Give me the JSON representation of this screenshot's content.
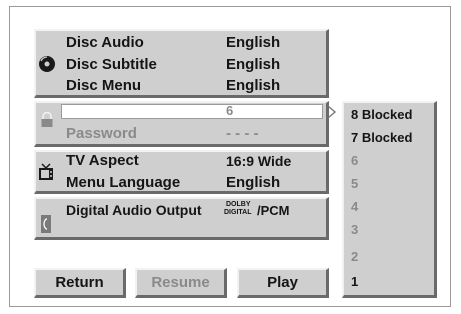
{
  "menu": {
    "disc_audio": {
      "label": "Disc Audio",
      "value": "English"
    },
    "disc_subtitle": {
      "label": "Disc Subtitle",
      "value": "English"
    },
    "disc_menu": {
      "label": "Disc Menu",
      "value": "English"
    },
    "rating_value": "6",
    "password": {
      "label": "Password",
      "value": "- - - -"
    },
    "tv_aspect": {
      "label": "TV Aspect",
      "value": "16:9 Wide"
    },
    "menu_language": {
      "label": "Menu Language",
      "value": "English"
    },
    "digital_audio_output": {
      "label": "Digital Audio Output",
      "dolby_line1": "DOLBY",
      "dolby_line2": "DIGITAL",
      "value": "/PCM"
    }
  },
  "rating_list": [
    "8 Blocked",
    "7 Blocked",
    "6",
    "5",
    "4",
    "3",
    "2",
    "1"
  ],
  "buttons": {
    "return": "Return",
    "resume": "Resume",
    "play": "Play"
  },
  "icons": [
    "disc-icon",
    "lock-icon",
    "tv-icon",
    "speaker-icon",
    "arrow-right-icon"
  ]
}
